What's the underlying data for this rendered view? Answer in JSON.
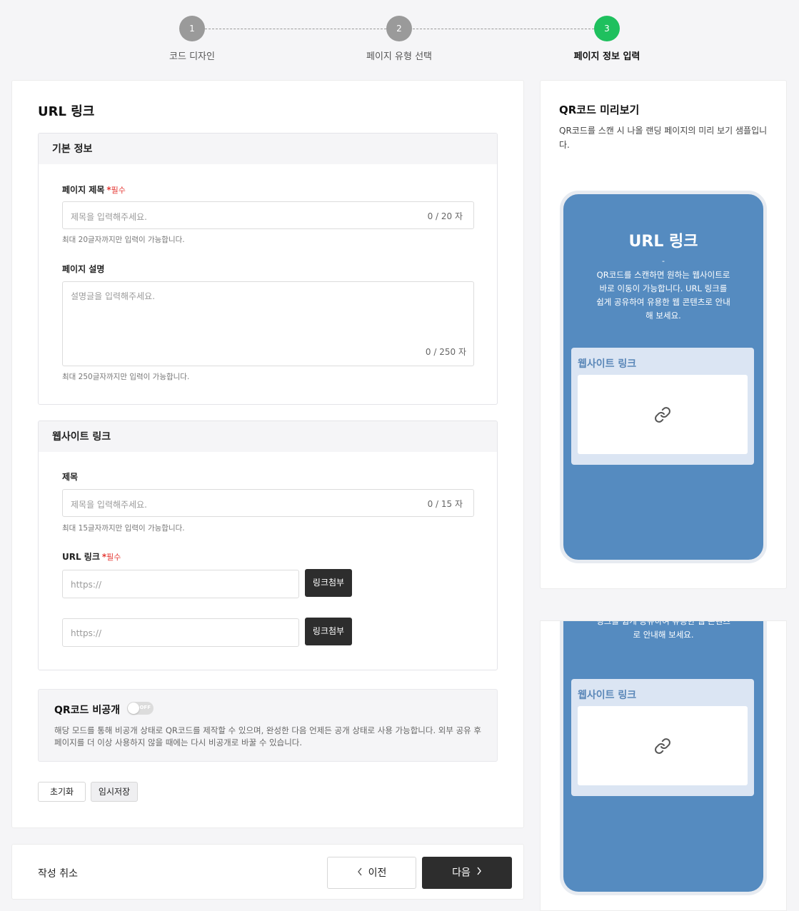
{
  "stepper": {
    "steps": [
      {
        "number": "1",
        "label": "코드 디자인"
      },
      {
        "number": "2",
        "label": "페이지 유형 선택"
      },
      {
        "number": "3",
        "label": "페이지 정보 입력"
      }
    ],
    "active_step": 3
  },
  "main": {
    "heading": "URL 링크",
    "basic_info": {
      "header": "기본 정보",
      "title_field": {
        "label": "페이지 제목",
        "required_star": "*",
        "required_text": "필수",
        "placeholder": "제목을 입력해주세요.",
        "counter": "0 / 20 자",
        "help": "최대 20글자까지만 입력이 가능합니다."
      },
      "desc_field": {
        "label": "페이지 설명",
        "placeholder": "설명글을 입력해주세요.",
        "counter": "0 / 250 자",
        "help": "최대 250글자까지만 입력이 가능합니다."
      }
    },
    "website_link": {
      "header": "웹사이트 링크",
      "title_field": {
        "label": "제목",
        "placeholder": "제목을 입력해주세요.",
        "counter": "0 / 15 자",
        "help": "최대 15글자까지만 입력이 가능합니다."
      },
      "url_field": {
        "label": "URL 링크",
        "required_star": "*",
        "required_text": "필수",
        "placeholder": "https://",
        "attach_label": "링크첨부"
      },
      "url_field_2": {
        "placeholder": "https://",
        "attach_label": "링크첨부"
      }
    },
    "private": {
      "title": "QR코드 비공개",
      "toggle_text": "OFF",
      "description": "해당 모드를 통해 비공개 상태로 QR코드를 제작할 수 있으며, 완성한 다음 언제든 공개 상태로 사용 가능합니다. 외부 공유 후 페이지를 더 이상 사용하지 않을 때에는 다시 비공개로 바꿀 수 있습니다."
    },
    "buttons": {
      "reset": "초기화",
      "temp_save": "임시저장"
    }
  },
  "bottom_bar": {
    "cancel": "작성 취소",
    "prev": "이전",
    "next": "다음"
  },
  "preview": {
    "title": "QR코드 미리보기",
    "description": "QR코드를 스캔 시 나올 랜딩 페이지의 미리 보기 샘플입니다.",
    "phone": {
      "title": "URL 링크",
      "dash": "-",
      "description": "QR코드를 스캔하면 원하는 웹사이트로 바로 이동이 가능합니다. URL 링크를 쉽게 공유하여 유용한 웹 콘텐츠로 안내해 보세요.",
      "description_tail": "링크를 쉽게 공유하여 유용한 웹 콘텐츠로 안내해 보세요.",
      "link_card_title": "웹사이트 링크",
      "link_icon": "chain-link-icon"
    }
  },
  "colors": {
    "accent_green": "#1fc05e",
    "phone_bg": "#558bc0",
    "dark_button": "#2d2d2d",
    "required_red": "#e53935"
  }
}
